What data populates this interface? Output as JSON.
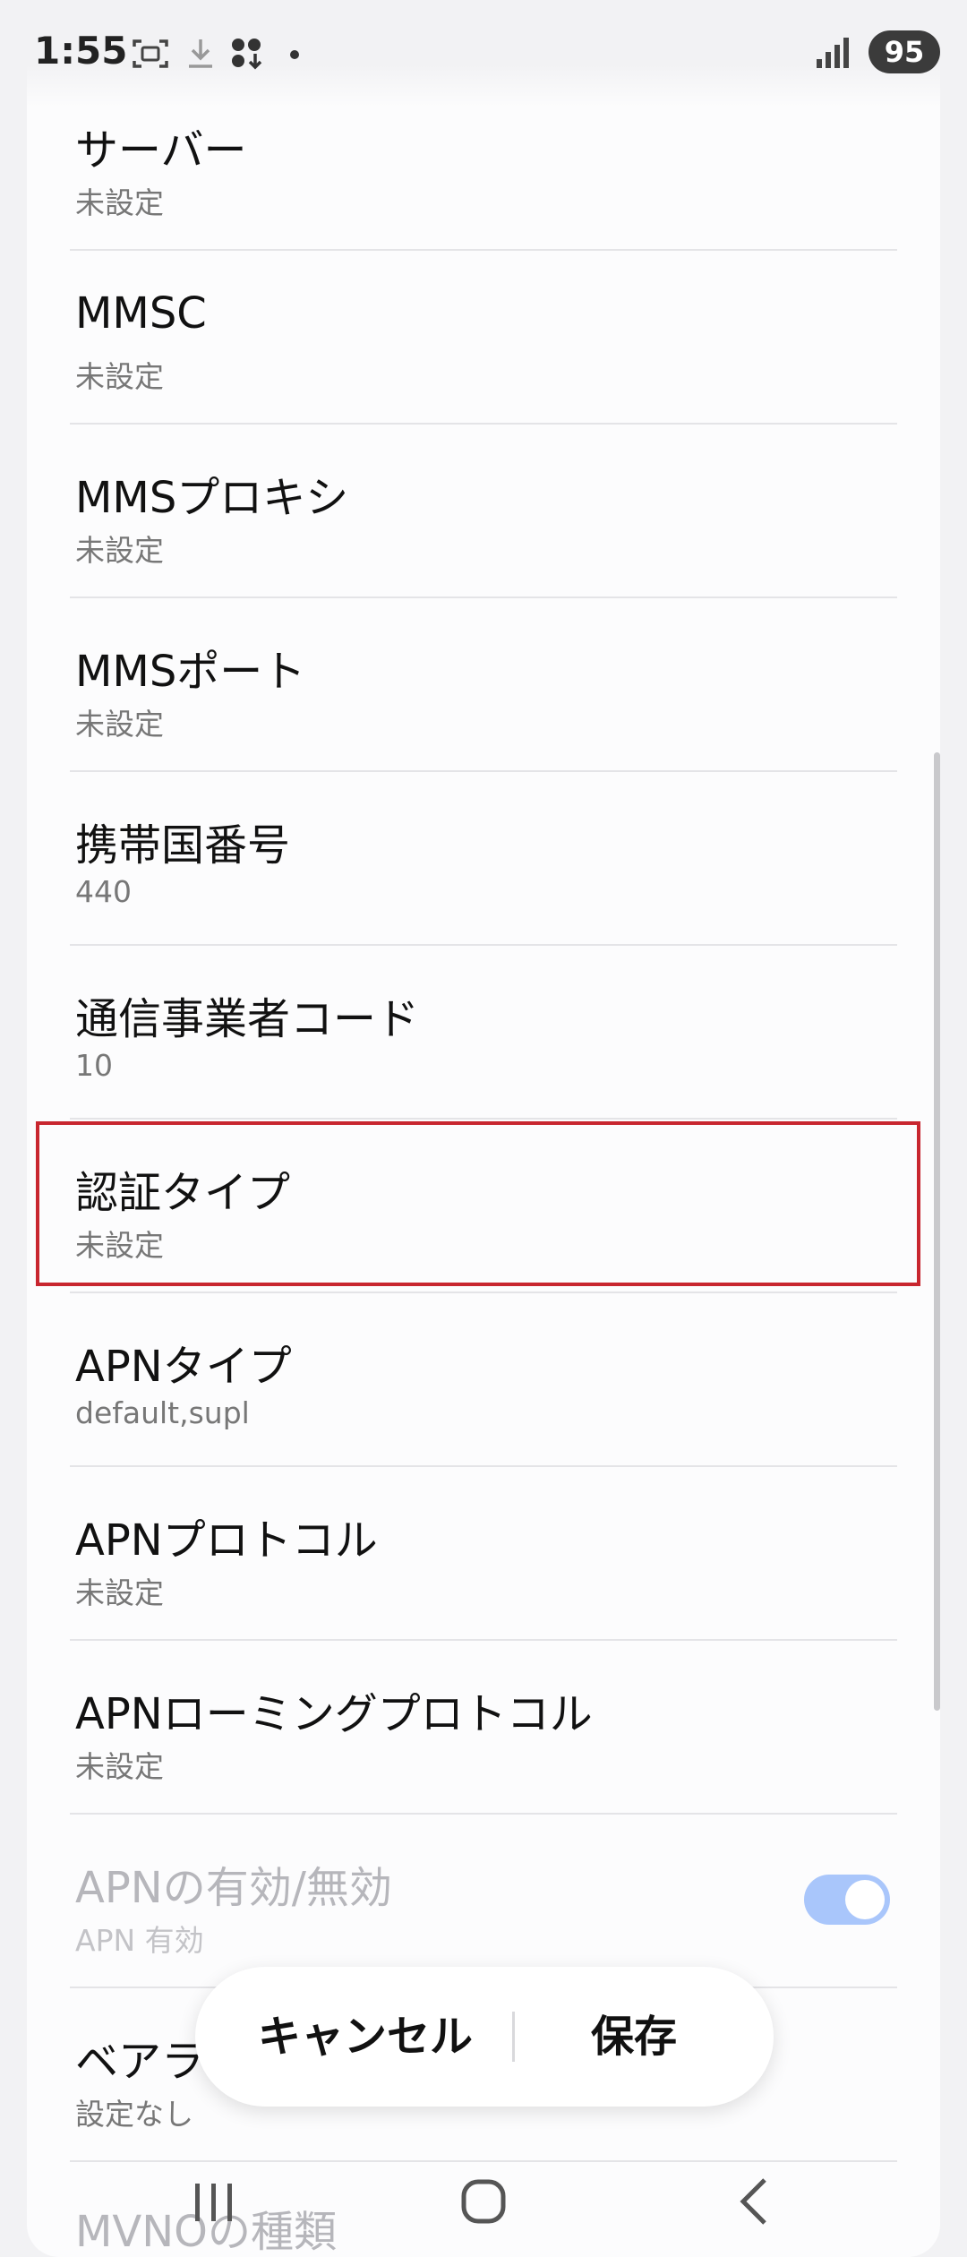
{
  "status": {
    "time": "1:55",
    "battery": "95"
  },
  "items": [
    {
      "title": "サーバー",
      "value": "未設定"
    },
    {
      "title": "MMSC",
      "value": "未設定"
    },
    {
      "title": "MMSプロキシ",
      "value": "未設定"
    },
    {
      "title": "MMSポート",
      "value": "未設定"
    },
    {
      "title": "携帯国番号",
      "value": "440"
    },
    {
      "title": "通信事業者コード",
      "value": "10"
    },
    {
      "title": "認証タイプ",
      "value": "未設定"
    },
    {
      "title": "APNタイプ",
      "value": "default,supl"
    },
    {
      "title": "APNプロトコル",
      "value": "未設定"
    },
    {
      "title": "APNローミングプロトコル",
      "value": "未設定"
    },
    {
      "title": "APNの有効/無効",
      "value": "APN 有効",
      "toggle_on": true
    },
    {
      "title": "ベアラ",
      "value": "設定なし"
    },
    {
      "title": "MVNOの種類",
      "value": ""
    }
  ],
  "actions": {
    "cancel": "キャンセル",
    "save": "保存"
  },
  "colors": {
    "highlight": "#c8262f",
    "toggle": "#a9c6fb"
  }
}
